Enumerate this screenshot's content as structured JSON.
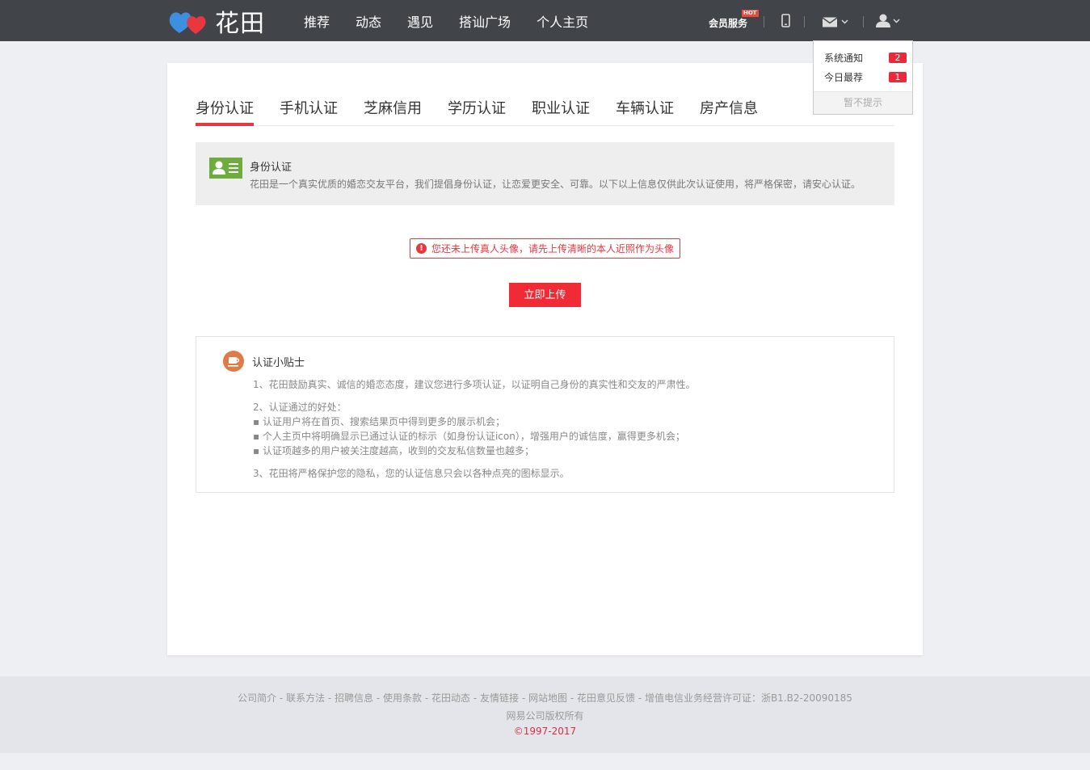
{
  "header": {
    "logo_text": "花田",
    "nav": [
      "推荐",
      "动态",
      "遇见",
      "搭讪广场",
      "个人主页"
    ],
    "vip_label": "会员服务",
    "hot_badge": "HOT"
  },
  "notifications": {
    "items": [
      {
        "label": "系统通知",
        "count": "2"
      },
      {
        "label": "今日最荐",
        "count": "1"
      }
    ],
    "dismiss_label": "暂不提示"
  },
  "tabs": [
    "身份认证",
    "手机认证",
    "芝麻信用",
    "学历认证",
    "职业认证",
    "车辆认证",
    "房产信息"
  ],
  "intro": {
    "title": "身份认证",
    "description": "花田是一个真实优质的婚恋交友平台，我们提倡身份认证，让恋爱更安全、可靠。以下以上信息仅供此次认证使用，将严格保密，请安心认证。"
  },
  "warning": {
    "icon": "!",
    "text": "您还未上传真人头像，请先上传清晰的本人近照作为头像"
  },
  "upload_button": "立即上传",
  "tips": {
    "title": "认证小贴士",
    "line1": "1、花田鼓励真实、诚信的婚恋态度，建议您进行多项认证，以证明自己身份的真实性和交友的严肃性。",
    "line2": "2、认证通过的好处：",
    "bullets": [
      "▪ 认证用户将在首页、搜索结果页中得到更多的展示机会；",
      "▪ 个人主页中将明确显示已通过认证的标示（如身份认证icon），增强用户的诚信度，赢得更多机会；",
      "▪ 认证项越多的用户被关注度越高，收到的交友私信数量也越多；"
    ],
    "line3": "3、花田将严格保护您的隐私，您的认证信息只会以各种点亮的图标显示。"
  },
  "footer": {
    "links": [
      "公司简介",
      "联系方法",
      "招聘信息",
      "使用条款",
      "花田动态",
      "友情链接",
      "网站地图",
      "花田意见反馈",
      "增值电信业务经营许可证：浙B1.B2-20090185"
    ],
    "copyright": "网易公司版权所有",
    "year": "©1997-2017"
  },
  "colors": {
    "topbar": "#414449",
    "accent_red": "#e8373f",
    "badge_red": "#ea2a3a",
    "intro_icon_green": "#6cad3c",
    "tips_icon_orange": "#e07a46"
  }
}
